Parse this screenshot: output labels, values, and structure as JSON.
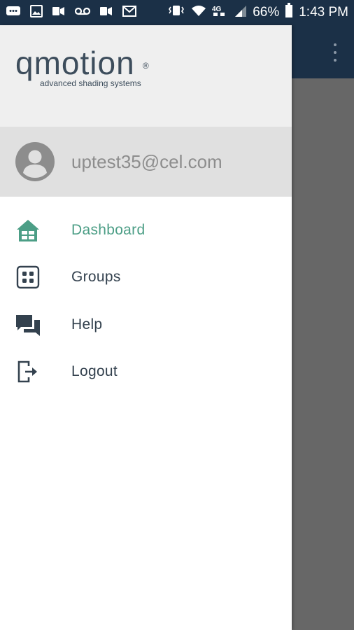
{
  "status_bar": {
    "battery_percent": "66%",
    "time": "1:43 PM",
    "left_icons": [
      "message-icon",
      "gallery-icon",
      "voicemail-icon",
      "voicemail-icon",
      "message-icon",
      "gmail-icon"
    ],
    "right_icons": [
      "vibrate-icon",
      "wifi-icon",
      "lte-icon",
      "signal-icon",
      "battery-icon"
    ]
  },
  "app_bar": {
    "overflow_icon": "more-vert-icon"
  },
  "drawer": {
    "logo": {
      "brand": "qmotion",
      "registered_mark": "®",
      "tagline": "advanced shading systems"
    },
    "user": {
      "email": "uptest35@cel.com",
      "avatar_icon": "account-circle-icon"
    },
    "menu": [
      {
        "label": "Dashboard",
        "icon": "home-icon",
        "active": true
      },
      {
        "label": "Groups",
        "icon": "groups-grid-icon",
        "active": false
      },
      {
        "label": "Help",
        "icon": "chat-icon",
        "active": false
      },
      {
        "label": "Logout",
        "icon": "logout-icon",
        "active": false
      }
    ]
  },
  "colors": {
    "status_bar_bg": "#1b3047",
    "accent_active": "#4c9e86",
    "menu_text": "#33414e",
    "header_bg": "#efefef",
    "user_row_bg": "#e0e0e0",
    "scrim": "#676767"
  }
}
